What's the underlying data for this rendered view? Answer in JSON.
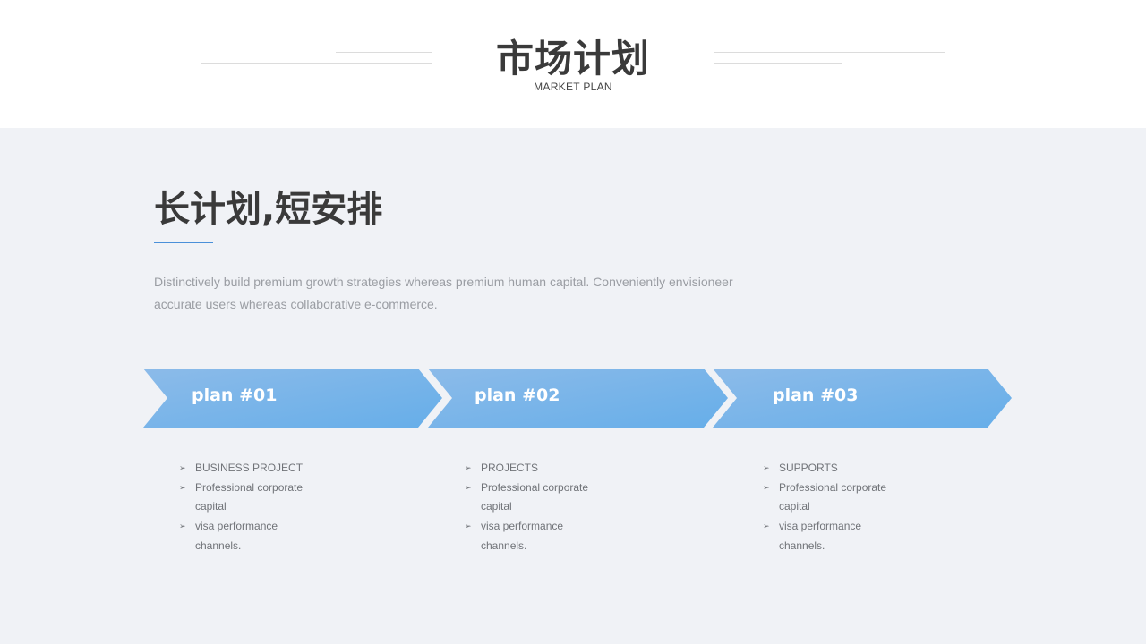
{
  "header": {
    "title": "市场计划",
    "subtitle": "MARKET PLAN"
  },
  "main": {
    "heading": "长计划,短安排",
    "description_line1": "Distinctively build premium growth strategies whereas premium human capital. Conveniently envisioneer",
    "description_line2": "accurate users whereas collaborative e-commerce."
  },
  "plans": [
    {
      "label": "plan #01",
      "items": [
        [
          "BUSINESS PROJECT"
        ],
        [
          "Professional corporate",
          "capital"
        ],
        [
          "visa performance",
          "channels."
        ]
      ]
    },
    {
      "label": "plan #02",
      "items": [
        [
          "PROJECTS"
        ],
        [
          "Professional corporate",
          "capital"
        ],
        [
          "visa performance",
          "channels."
        ]
      ]
    },
    {
      "label": "plan #03",
      "items": [
        [
          "SUPPORTS"
        ],
        [
          "Professional corporate",
          "capital"
        ],
        [
          "visa performance",
          "channels."
        ]
      ]
    }
  ],
  "colors": {
    "arrow_start": "#8ab8e8",
    "arrow_end": "#6aaeea",
    "accent": "#4a90d9",
    "background": "#f0f2f6"
  },
  "icons": {
    "bullet": "arrowhead-bullet-icon",
    "bullet_glyph": "➢"
  }
}
